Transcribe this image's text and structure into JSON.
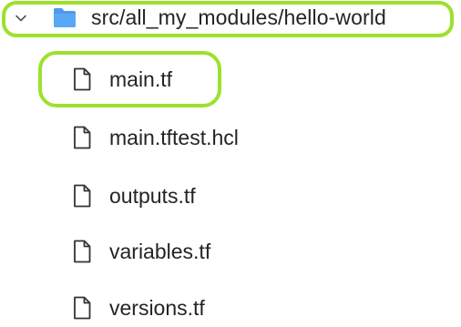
{
  "folder": {
    "label": "src/all_my_modules/hello-world",
    "expanded": true,
    "icon": "folder-icon",
    "color": "#4d9bf0"
  },
  "files": [
    {
      "label": "main.tf",
      "icon": "file-icon",
      "highlighted": true
    },
    {
      "label": "main.tftest.hcl",
      "icon": "file-icon",
      "highlighted": false
    },
    {
      "label": "outputs.tf",
      "icon": "file-icon",
      "highlighted": false
    },
    {
      "label": "variables.tf",
      "icon": "file-icon",
      "highlighted": false
    },
    {
      "label": "versions.tf",
      "icon": "file-icon",
      "highlighted": false
    }
  ],
  "highlight_color": "#9be22c"
}
